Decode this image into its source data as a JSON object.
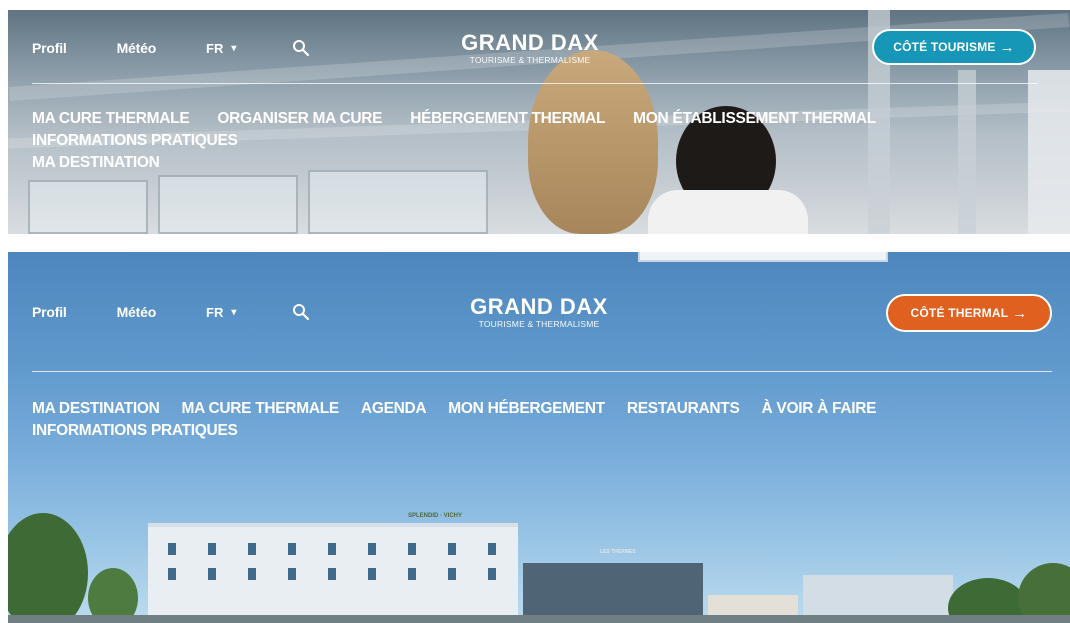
{
  "thermal_site": {
    "topbar": {
      "profile": "Profil",
      "weather": "Météo",
      "language": "FR",
      "brand_name": "GRAND DAX",
      "brand_tagline": "TOURISME & THERMALISME",
      "cta_label": "CÔTÉ TOURISME",
      "cta_color": "#1797b7"
    },
    "menu": [
      "MA CURE THERMALE",
      "ORGANISER MA CURE",
      "HÉBERGEMENT THERMAL",
      "MON ÉTABLISSEMENT THERMAL",
      "INFORMATIONS PRATIQUES",
      "MA DESTINATION"
    ]
  },
  "tourism_site": {
    "topbar": {
      "profile": "Profil",
      "weather": "Météo",
      "language": "FR",
      "brand_name": "GRAND DAX",
      "brand_tagline": "TOURISME & THERMALISME",
      "cta_label": "CÔTÉ THERMAL",
      "cta_color": "#e0601f"
    },
    "menu": [
      "MA DESTINATION",
      "MA CURE THERMALE",
      "AGENDA",
      "MON HÉBERGEMENT",
      "RESTAURANTS",
      "À VOIR À FAIRE",
      "INFORMATIONS PRATIQUES"
    ],
    "hotel_sign": "SPLENDID · VICHY",
    "building_sign": "LES THERMES"
  }
}
